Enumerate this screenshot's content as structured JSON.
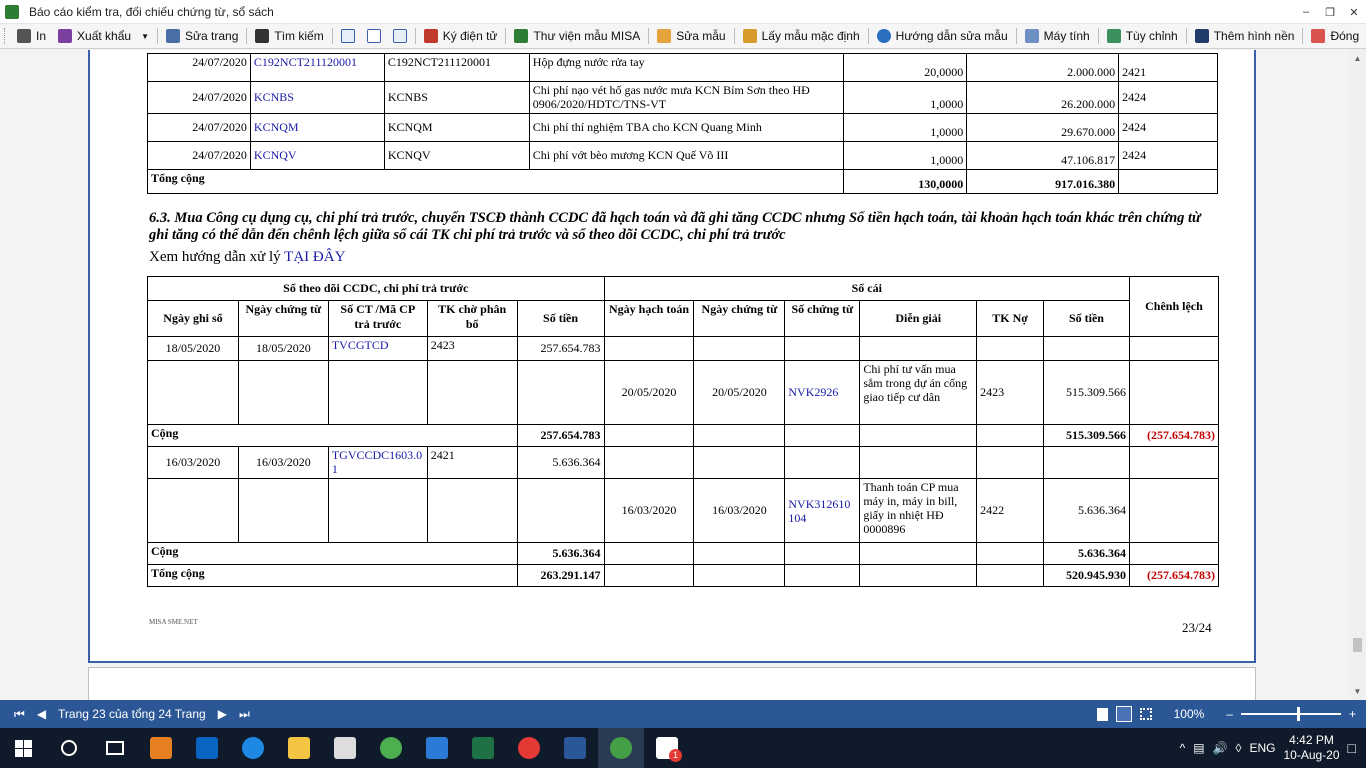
{
  "window": {
    "title": "Báo cáo kiểm tra, đối chiếu chứng từ, sổ sách"
  },
  "toolbar": {
    "print": "In",
    "export": "Xuất khẩu",
    "edit_page": "Sửa trang",
    "search": "Tìm kiếm",
    "sign": "Ký điện tử",
    "library": "Thư viện mẫu MISA",
    "edit_template": "Sửa mẫu",
    "default_template": "Lấy mẫu mặc định",
    "guide": "Hướng dẫn sửa mẫu",
    "calculator": "Máy tính",
    "customize": "Tùy chỉnh",
    "background": "Thêm hình nền",
    "close": "Đóng"
  },
  "top_table": {
    "rows": [
      {
        "date": "24/07/2020",
        "code": "C192NCT211120001",
        "code2": "C192NCT211120001",
        "desc": "Hộp đựng nước rửa tay",
        "qty": "20,0000",
        "amount": "2.000.000",
        "account": "2421"
      },
      {
        "date": "24/07/2020",
        "code": "KCNBS",
        "code2": "KCNBS",
        "desc": "Chi phí nạo vét hố gas nước mưa KCN Bỉm Sơn theo HĐ 0906/2020/HDTC/TNS-VT",
        "qty": "1,0000",
        "amount": "26.200.000",
        "account": "2424"
      },
      {
        "date": "24/07/2020",
        "code": "KCNQM",
        "code2": "KCNQM",
        "desc": "Chi phí thí nghiệm TBA cho KCN Quang Minh",
        "qty": "1,0000",
        "amount": "29.670.000",
        "account": "2424"
      },
      {
        "date": "24/07/2020",
        "code": "KCNQV",
        "code2": "KCNQV",
        "desc": "Chi phí vớt bèo mương KCN Quế Võ III",
        "qty": "1,0000",
        "amount": "47.106.817",
        "account": "2424"
      }
    ],
    "total_label": "Tổng cộng",
    "total_qty": "130,0000",
    "total_amount": "917.016.380"
  },
  "section": {
    "heading": "6.3. Mua Công cụ dụng cụ, chi phí trả trước, chuyển TSCĐ thành CCDC đã hạch toán và đã ghi tăng CCDC nhưng Số tiền hạch toán, tài khoản hạch toán khác trên chứng từ ghi tăng có thể dẫn đến chênh lệch giữa sổ cái TK chi phí trả trước và sổ theo dõi CCDC, chi phí trả trước",
    "guide_text": "Xem hướng dẫn xử lý",
    "guide_link": "TẠI ĐÂY"
  },
  "main_table": {
    "group1": "Sổ theo dõi CCDC, chi phí trả trước",
    "group2": "Sổ cái",
    "diff": "Chênh lệch",
    "h": {
      "c1": "Ngày ghi sổ",
      "c2": "Ngày chứng từ",
      "c3": "Số CT /Mã CP trả trước",
      "c4": "TK chờ phân bổ",
      "c5": "Số tiền",
      "c6": "Ngày hạch toán",
      "c7": "Ngày chứng từ",
      "c8": "Số chứng từ",
      "c9": "Diễn giải",
      "c10": "TK Nợ",
      "c11": "Số tiền"
    },
    "g1": {
      "a": {
        "date": "18/05/2020",
        "doc_date": "18/05/2020",
        "code": "TVCGTCD",
        "acc": "2423",
        "amount": "257.654.783"
      },
      "b": {
        "date": "20/05/2020",
        "doc_date": "20/05/2020",
        "code": "NVK2926",
        "desc": "Chi phí tư vấn mua sắm trong dự án cổng giao tiếp cư dân",
        "acc": "2423",
        "amount": "515.309.566"
      },
      "sub_label": "Cộng",
      "sub_left": "257.654.783",
      "sub_right": "515.309.566",
      "sub_diff": "(257.654.783)"
    },
    "g2": {
      "a": {
        "date": "16/03/2020",
        "doc_date": "16/03/2020",
        "code": "TGVCCDC1603.01",
        "acc": "2421",
        "amount": "5.636.364"
      },
      "b": {
        "date": "16/03/2020",
        "doc_date": "16/03/2020",
        "code": "NVK312610104",
        "desc": "Thanh toán CP mua máy in, máy in bill, giấy in nhiệt HĐ 0000896",
        "acc": "2422",
        "amount": "5.636.364"
      },
      "sub_label": "Cộng",
      "sub_left": "5.636.364",
      "sub_right": "5.636.364"
    },
    "total_label": "Tổng cộng",
    "total_left": "263.291.147",
    "total_right": "520.945.930",
    "total_diff": "(257.654.783)"
  },
  "footer": {
    "brand": "MISA SME.NET",
    "page": "23/24"
  },
  "statusbar": {
    "page_info": "Trang 23 của tổng 24 Trang",
    "zoom": "100%"
  },
  "taskbar": {
    "lang": "ENG",
    "time": "4:42 PM",
    "date": "10-Aug-20",
    "badge": "1"
  },
  "colors": {
    "statusbar": "#2b5797",
    "link": "#1a1aa8",
    "negative": "#c00000",
    "page_border": "#3b5ea8"
  }
}
